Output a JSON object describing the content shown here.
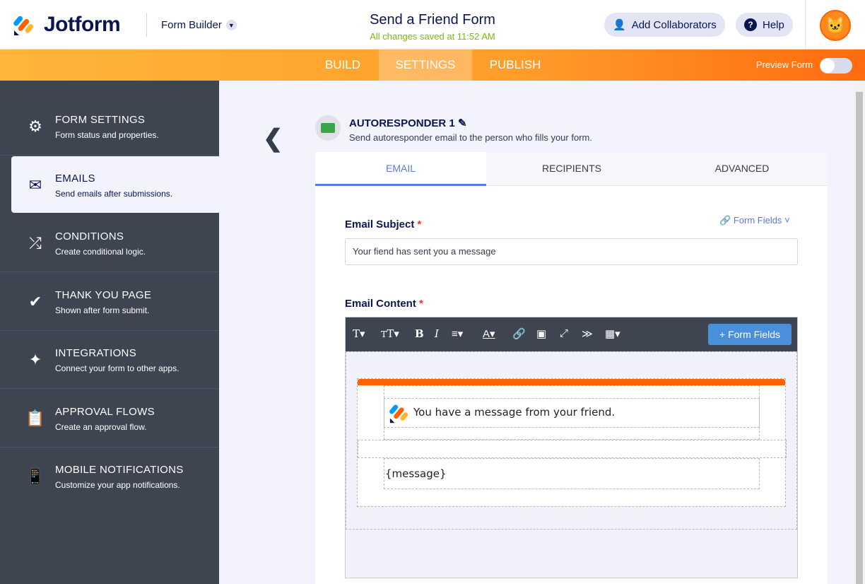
{
  "header": {
    "brand": "Jotform",
    "builder_label": "Form Builder",
    "form_title": "Send a Friend Form",
    "save_status": "All changes saved at 11:52 AM",
    "add_collaborators": "Add Collaborators",
    "help": "Help"
  },
  "nav": {
    "tabs": [
      "BUILD",
      "SETTINGS",
      "PUBLISH"
    ],
    "active": "SETTINGS",
    "preview_label": "Preview Form",
    "preview_on": false
  },
  "sidebar": {
    "items": [
      {
        "label": "FORM SETTINGS",
        "desc": "Form status and properties.",
        "icon": "gear-icon"
      },
      {
        "label": "EMAILS",
        "desc": "Send emails after submissions.",
        "icon": "envelope-icon"
      },
      {
        "label": "CONDITIONS",
        "desc": "Create conditional logic.",
        "icon": "shuffle-icon"
      },
      {
        "label": "THANK YOU PAGE",
        "desc": "Shown after form submit.",
        "icon": "check-circle-icon"
      },
      {
        "label": "INTEGRATIONS",
        "desc": "Connect your form to other apps.",
        "icon": "puzzle-icon"
      },
      {
        "label": "APPROVAL FLOWS",
        "desc": "Create an approval flow.",
        "icon": "approval-icon"
      },
      {
        "label": "MOBILE NOTIFICATIONS",
        "desc": "Customize your app notifications.",
        "icon": "mobile-icon"
      }
    ]
  },
  "autoresponder": {
    "title": "AUTORESPONDER 1",
    "desc": "Send autoresponder email to the person who fills your form."
  },
  "tabs": [
    "EMAIL",
    "RECIPIENTS",
    "ADVANCED"
  ],
  "form": {
    "subject_label": "Email Subject",
    "required": "*",
    "form_fields": "Form Fields",
    "subject_value": "Your fiend has sent you a message",
    "content_label": "Email Content",
    "toolbar_form_fields": "+ Form Fields",
    "email_heading": "You have a message from your friend.",
    "email_body": "{message}"
  }
}
